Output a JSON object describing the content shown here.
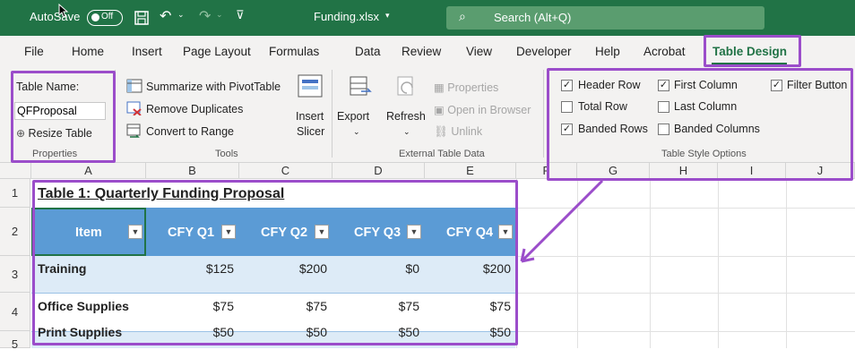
{
  "titlebar": {
    "autosave_label": "AutoSave",
    "autosave_state": "Off",
    "filename": "Funding.xlsx",
    "search_placeholder": "Search (Alt+Q)"
  },
  "menu": [
    "File",
    "Home",
    "Insert",
    "Page Layout",
    "Formulas",
    "Data",
    "Review",
    "View",
    "Developer",
    "Help",
    "Acrobat",
    "Table Design"
  ],
  "ribbon": {
    "properties": {
      "table_name_label": "Table Name:",
      "table_name_value": "QFProposal",
      "resize_label": "Resize Table",
      "group_label": "Properties"
    },
    "tools": {
      "summarize": "Summarize with PivotTable",
      "remove_duplicates": "Remove Duplicates",
      "convert": "Convert to Range",
      "insert_slicer_1": "Insert",
      "insert_slicer_2": "Slicer",
      "group_label": "Tools"
    },
    "external": {
      "export": "Export",
      "refresh": "Refresh",
      "properties": "Properties",
      "open_browser": "Open in Browser",
      "unlink": "Unlink",
      "group_label": "External Table Data"
    },
    "style_options": {
      "header_row": "Header Row",
      "total_row": "Total Row",
      "banded_rows": "Banded Rows",
      "first_column": "First Column",
      "last_column": "Last Column",
      "banded_columns": "Banded Columns",
      "filter_button": "Filter Button",
      "group_label": "Table Style Options"
    }
  },
  "grid": {
    "columns": [
      "A",
      "B",
      "C",
      "D",
      "E",
      "F",
      "G",
      "H",
      "I",
      "J"
    ],
    "rows": [
      "1",
      "2",
      "3",
      "4",
      "5"
    ],
    "title": "Table 1:  Quarterly Funding Proposal",
    "headers": [
      "Item",
      "CFY Q1",
      "CFY Q2",
      "CFY Q3",
      "CFY Q4"
    ],
    "data": [
      [
        "Training",
        "$125",
        "$200",
        "$0",
        "$200"
      ],
      [
        "Office Supplies",
        "$75",
        "$75",
        "$75",
        "$75"
      ],
      [
        "Print Supplies",
        "$50",
        "$50",
        "$50",
        "$50"
      ]
    ]
  }
}
